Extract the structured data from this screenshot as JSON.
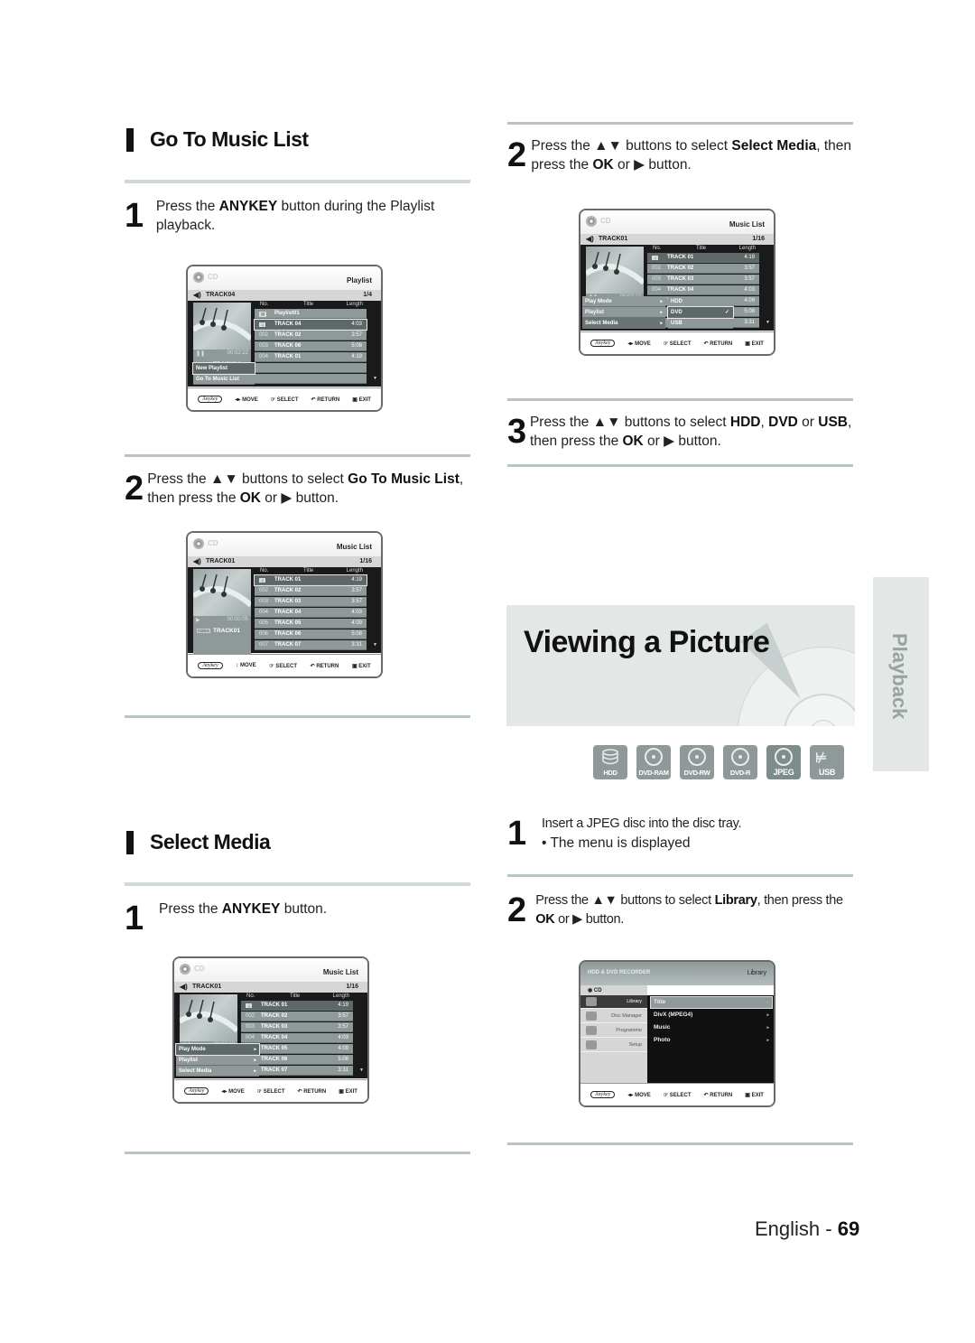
{
  "left": {
    "section1": {
      "title": "Go To Music List",
      "step1": {
        "num": "1",
        "text_a": "Press the ",
        "bold": "ANYKEY",
        "text_b": " button during the Playlist playback."
      },
      "step2": {
        "num": "2",
        "text_a": "Press the ▲▼ buttons to select ",
        "bold": "Go To Music List",
        "text_b": ", then press the ",
        "bold2": "OK",
        "text_c": " or ▶ button."
      }
    },
    "section2": {
      "title": "Select Media",
      "step1": {
        "num": "1",
        "text_a": "Press the ",
        "bold": "ANYKEY",
        "text_b": " button."
      }
    }
  },
  "right": {
    "step2": {
      "num": "2",
      "text_a": "Press the ▲▼ buttons to select ",
      "bold": "Select Media",
      "text_b": ", then press the ",
      "bold2": "OK",
      "text_c": " or ▶ button."
    },
    "step3": {
      "num": "3",
      "text_a": "Press the ▲▼ buttons to select ",
      "bold": "HDD",
      "sep": ", ",
      "bold2": "DVD",
      "text_b": " or ",
      "bold3": "USB",
      "text_c": ", then press the ",
      "bold4": "OK",
      "text_d": " or ▶ button."
    },
    "banner_title": "Viewing a Picture",
    "side_tab": "Playback",
    "badges": [
      "HDD",
      "DVD-RAM",
      "DVD-RW",
      "DVD-R",
      "JPEG",
      "USB"
    ],
    "vstep1": {
      "num": "1",
      "text": "Insert a JPEG disc into the disc tray.",
      "bullet": "• The menu is displayed"
    },
    "vstep2": {
      "num": "2",
      "text_a": "Press the ▲▼ buttons to select ",
      "bold": "Library",
      "text_b": ", then press the ",
      "bold2": "OK",
      "text_c": " or ▶ button."
    }
  },
  "footer": {
    "lang": "English - ",
    "page": "69"
  },
  "screens": {
    "common": {
      "cd": "CD",
      "col_no": "No.",
      "col_title": "Title",
      "col_length": "Length",
      "foot_anykey": "Anykey",
      "foot_move": "◂▸ MOVE",
      "foot_move_v": "↕ MOVE",
      "foot_select": "☞ SELECT",
      "foot_return": "↶ RETURN",
      "foot_exit": "▣ EXIT"
    },
    "playlist": {
      "mode": "Playlist",
      "track": "TRACK04",
      "page": "1/4",
      "time": "00:02:22",
      "now": "TRACK04",
      "rows": [
        {
          "no": "▤",
          "title": "Playlist01",
          "length": ""
        },
        {
          "no": "♫",
          "title": "TRACK 04",
          "length": "4:03"
        },
        {
          "no": "002",
          "title": "TRACK 02",
          "length": "3:57"
        },
        {
          "no": "003",
          "title": "TRACK 06",
          "length": "5:08"
        },
        {
          "no": "004",
          "title": "TRACK 01",
          "length": "4:19"
        }
      ],
      "popup": [
        "New Playlist",
        "Go To Music List"
      ]
    },
    "musiclist": {
      "mode": "Music List",
      "track": "TRACK01",
      "page": "1/16",
      "time": "00:00:05",
      "now": "TRACK01",
      "rows": [
        {
          "no": "♫",
          "title": "TRACK 01",
          "length": "4:19"
        },
        {
          "no": "002",
          "title": "TRACK 02",
          "length": "3:57"
        },
        {
          "no": "003",
          "title": "TRACK 03",
          "length": "3:57"
        },
        {
          "no": "004",
          "title": "TRACK 04",
          "length": "4:03"
        },
        {
          "no": "005",
          "title": "TRACK 05",
          "length": "4:09"
        },
        {
          "no": "006",
          "title": "TRACK 06",
          "length": "5:08"
        },
        {
          "no": "007",
          "title": "TRACK 07",
          "length": "3:31"
        }
      ]
    },
    "anykey_menu": {
      "mode": "Music List",
      "track": "TRACK01",
      "page": "1/16",
      "time": "00:02:22",
      "popup": [
        "Play Mode",
        "Playlist",
        "Select Media"
      ]
    },
    "media_menu": {
      "options": [
        "HDD",
        "DVD",
        "USB"
      ],
      "checked": "DVD"
    },
    "library": {
      "brand": "HDD & DVD RECORDER",
      "mode": "Library",
      "cd": "CD",
      "left": [
        "Library",
        "Disc Manager",
        "Programme",
        "Setup"
      ],
      "options": [
        "Title",
        "DivX (MPEG4)",
        "Music",
        "Photo"
      ]
    }
  }
}
